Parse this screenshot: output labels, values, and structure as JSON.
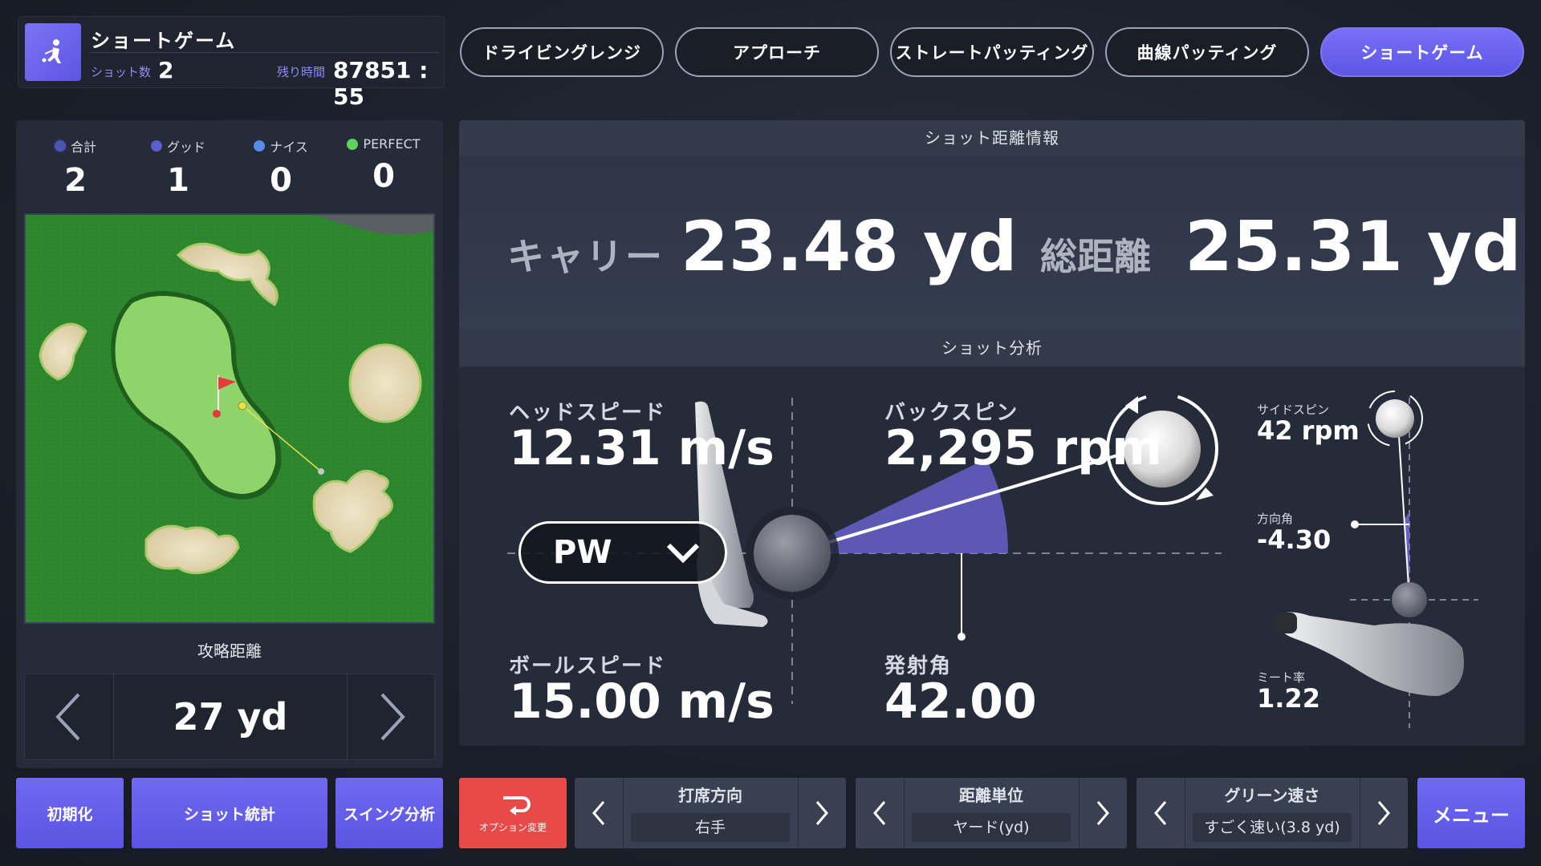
{
  "header": {
    "mode_title": "ショートゲーム",
    "shot_count_label": "ショット数",
    "shot_count": "2",
    "remaining_label": "残り時間",
    "remaining_time": "87851 : 55"
  },
  "tabs": [
    {
      "label": "ドライビングレンジ",
      "active": false
    },
    {
      "label": "アプローチ",
      "active": false
    },
    {
      "label": "ストレートパッティング",
      "active": false
    },
    {
      "label": "曲線パッティング",
      "active": false
    },
    {
      "label": "ショートゲーム",
      "active": true
    }
  ],
  "stats": [
    {
      "label": "合計",
      "value": "2",
      "color": "#4b56b0"
    },
    {
      "label": "グッド",
      "value": "1",
      "color": "#5a5fd0"
    },
    {
      "label": "ナイス",
      "value": "0",
      "color": "#5b8be8"
    },
    {
      "label": "PERFECT",
      "value": "0",
      "color": "#5ed15e"
    }
  ],
  "attack": {
    "label": "攻略距離",
    "value": "27 yd"
  },
  "distance": {
    "section_title": "ショット距離情報",
    "carry_label": "キャリー",
    "carry_value": "23.48 yd",
    "total_label": "総距離",
    "total_value": "25.31 yd"
  },
  "analysis": {
    "section_title": "ショット分析",
    "head_speed_label": "ヘッドスピード",
    "head_speed_value": "12.31 m/s",
    "backspin_label": "バックスピン",
    "backspin_value": "2,295 rpm",
    "ball_speed_label": "ボールスピード",
    "ball_speed_value": "15.00 m/s",
    "launch_angle_label": "発射角",
    "launch_angle_value": "42.00",
    "sidespin_label": "サイドスピン",
    "sidespin_value": "42 rpm",
    "direction_label": "方向角",
    "direction_value": "-4.30",
    "meet_rate_label": "ミート率",
    "meet_rate_value": "1.22",
    "club": "PW"
  },
  "bottom": {
    "reset": "初期化",
    "shot_stats": "ショット統計",
    "swing_analysis": "スイング分析",
    "option_change": "オプション変更",
    "hit_direction_title": "打席方向",
    "hit_direction_value": "右手",
    "distance_unit_title": "距離単位",
    "distance_unit_value": "ヤード(yd)",
    "green_speed_title": "グリーン速さ",
    "green_speed_value": "すごく速い(3.8 yd)",
    "menu": "メニュー"
  },
  "colors": {
    "accent": "#6b63ef",
    "danger": "#e84a4a",
    "panel": "#2c3342"
  }
}
